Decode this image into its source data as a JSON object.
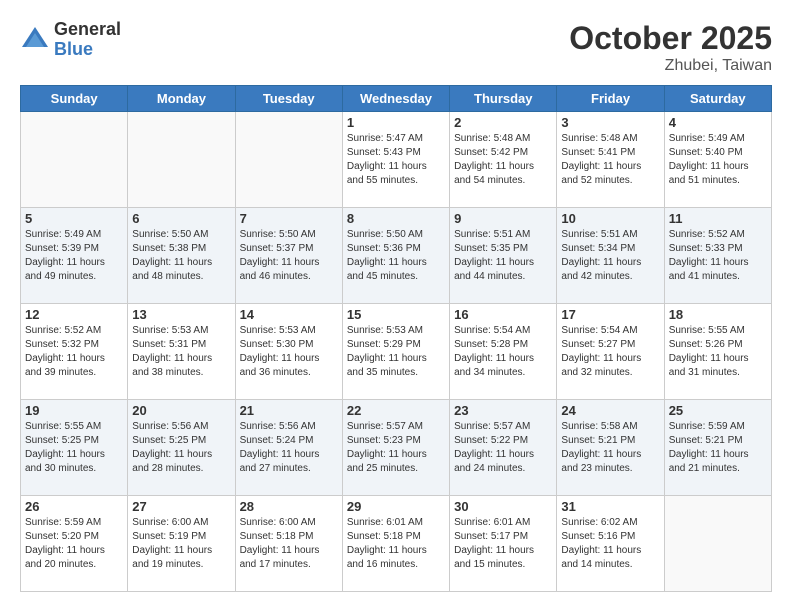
{
  "logo": {
    "general": "General",
    "blue": "Blue"
  },
  "header": {
    "month": "October 2025",
    "location": "Zhubei, Taiwan"
  },
  "weekdays": [
    "Sunday",
    "Monday",
    "Tuesday",
    "Wednesday",
    "Thursday",
    "Friday",
    "Saturday"
  ],
  "weeks": [
    [
      {
        "day": "",
        "info": ""
      },
      {
        "day": "",
        "info": ""
      },
      {
        "day": "",
        "info": ""
      },
      {
        "day": "1",
        "info": "Sunrise: 5:47 AM\nSunset: 5:43 PM\nDaylight: 11 hours\nand 55 minutes."
      },
      {
        "day": "2",
        "info": "Sunrise: 5:48 AM\nSunset: 5:42 PM\nDaylight: 11 hours\nand 54 minutes."
      },
      {
        "day": "3",
        "info": "Sunrise: 5:48 AM\nSunset: 5:41 PM\nDaylight: 11 hours\nand 52 minutes."
      },
      {
        "day": "4",
        "info": "Sunrise: 5:49 AM\nSunset: 5:40 PM\nDaylight: 11 hours\nand 51 minutes."
      }
    ],
    [
      {
        "day": "5",
        "info": "Sunrise: 5:49 AM\nSunset: 5:39 PM\nDaylight: 11 hours\nand 49 minutes."
      },
      {
        "day": "6",
        "info": "Sunrise: 5:50 AM\nSunset: 5:38 PM\nDaylight: 11 hours\nand 48 minutes."
      },
      {
        "day": "7",
        "info": "Sunrise: 5:50 AM\nSunset: 5:37 PM\nDaylight: 11 hours\nand 46 minutes."
      },
      {
        "day": "8",
        "info": "Sunrise: 5:50 AM\nSunset: 5:36 PM\nDaylight: 11 hours\nand 45 minutes."
      },
      {
        "day": "9",
        "info": "Sunrise: 5:51 AM\nSunset: 5:35 PM\nDaylight: 11 hours\nand 44 minutes."
      },
      {
        "day": "10",
        "info": "Sunrise: 5:51 AM\nSunset: 5:34 PM\nDaylight: 11 hours\nand 42 minutes."
      },
      {
        "day": "11",
        "info": "Sunrise: 5:52 AM\nSunset: 5:33 PM\nDaylight: 11 hours\nand 41 minutes."
      }
    ],
    [
      {
        "day": "12",
        "info": "Sunrise: 5:52 AM\nSunset: 5:32 PM\nDaylight: 11 hours\nand 39 minutes."
      },
      {
        "day": "13",
        "info": "Sunrise: 5:53 AM\nSunset: 5:31 PM\nDaylight: 11 hours\nand 38 minutes."
      },
      {
        "day": "14",
        "info": "Sunrise: 5:53 AM\nSunset: 5:30 PM\nDaylight: 11 hours\nand 36 minutes."
      },
      {
        "day": "15",
        "info": "Sunrise: 5:53 AM\nSunset: 5:29 PM\nDaylight: 11 hours\nand 35 minutes."
      },
      {
        "day": "16",
        "info": "Sunrise: 5:54 AM\nSunset: 5:28 PM\nDaylight: 11 hours\nand 34 minutes."
      },
      {
        "day": "17",
        "info": "Sunrise: 5:54 AM\nSunset: 5:27 PM\nDaylight: 11 hours\nand 32 minutes."
      },
      {
        "day": "18",
        "info": "Sunrise: 5:55 AM\nSunset: 5:26 PM\nDaylight: 11 hours\nand 31 minutes."
      }
    ],
    [
      {
        "day": "19",
        "info": "Sunrise: 5:55 AM\nSunset: 5:25 PM\nDaylight: 11 hours\nand 30 minutes."
      },
      {
        "day": "20",
        "info": "Sunrise: 5:56 AM\nSunset: 5:25 PM\nDaylight: 11 hours\nand 28 minutes."
      },
      {
        "day": "21",
        "info": "Sunrise: 5:56 AM\nSunset: 5:24 PM\nDaylight: 11 hours\nand 27 minutes."
      },
      {
        "day": "22",
        "info": "Sunrise: 5:57 AM\nSunset: 5:23 PM\nDaylight: 11 hours\nand 25 minutes."
      },
      {
        "day": "23",
        "info": "Sunrise: 5:57 AM\nSunset: 5:22 PM\nDaylight: 11 hours\nand 24 minutes."
      },
      {
        "day": "24",
        "info": "Sunrise: 5:58 AM\nSunset: 5:21 PM\nDaylight: 11 hours\nand 23 minutes."
      },
      {
        "day": "25",
        "info": "Sunrise: 5:59 AM\nSunset: 5:21 PM\nDaylight: 11 hours\nand 21 minutes."
      }
    ],
    [
      {
        "day": "26",
        "info": "Sunrise: 5:59 AM\nSunset: 5:20 PM\nDaylight: 11 hours\nand 20 minutes."
      },
      {
        "day": "27",
        "info": "Sunrise: 6:00 AM\nSunset: 5:19 PM\nDaylight: 11 hours\nand 19 minutes."
      },
      {
        "day": "28",
        "info": "Sunrise: 6:00 AM\nSunset: 5:18 PM\nDaylight: 11 hours\nand 17 minutes."
      },
      {
        "day": "29",
        "info": "Sunrise: 6:01 AM\nSunset: 5:18 PM\nDaylight: 11 hours\nand 16 minutes."
      },
      {
        "day": "30",
        "info": "Sunrise: 6:01 AM\nSunset: 5:17 PM\nDaylight: 11 hours\nand 15 minutes."
      },
      {
        "day": "31",
        "info": "Sunrise: 6:02 AM\nSunset: 5:16 PM\nDaylight: 11 hours\nand 14 minutes."
      },
      {
        "day": "",
        "info": ""
      }
    ]
  ]
}
